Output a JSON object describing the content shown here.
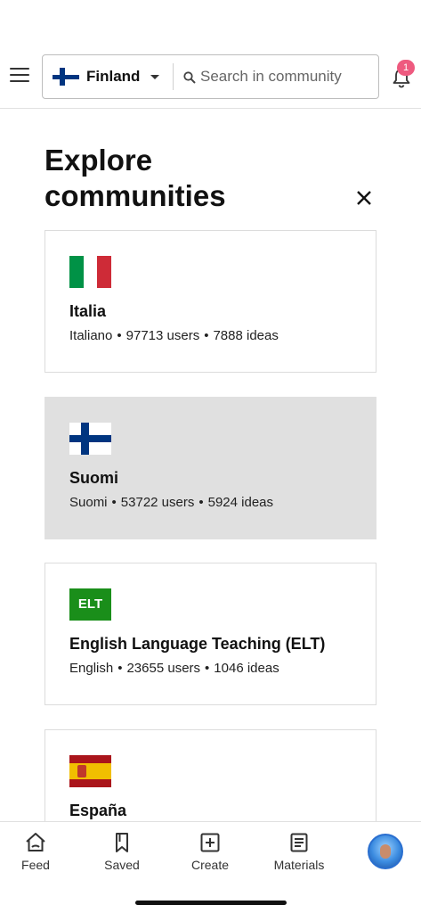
{
  "header": {
    "community": "Finland",
    "search_placeholder": "Search in community",
    "notification_count": "1"
  },
  "page": {
    "title": "Explore communities"
  },
  "communities": [
    {
      "name": "Italia",
      "language": "Italiano",
      "users": "97713 users",
      "ideas": "7888 ideas",
      "flag": "italy-flag",
      "selected": false
    },
    {
      "name": "Suomi",
      "language": "Suomi",
      "users": "53722 users",
      "ideas": "5924 ideas",
      "flag": "finland-flag",
      "selected": true
    },
    {
      "name": "English Language Teaching (ELT)",
      "language": "English",
      "users": "23655 users",
      "ideas": "1046 ideas",
      "flag": "elt-badge",
      "badge_text": "ELT",
      "selected": false
    },
    {
      "name": "España",
      "flag": "spain-flag",
      "selected": false
    }
  ],
  "bottom_nav": {
    "items": [
      {
        "label": "Feed",
        "icon": "home-icon"
      },
      {
        "label": "Saved",
        "icon": "bookmark-icon"
      },
      {
        "label": "Create",
        "icon": "plus-square-icon"
      },
      {
        "label": "Materials",
        "icon": "document-icon"
      }
    ]
  },
  "colors": {
    "accent_badge": "#ee5a7f",
    "selected_card": "#e0e0e0",
    "elt_green": "#1a8e1a",
    "finland_blue": "#003580"
  }
}
